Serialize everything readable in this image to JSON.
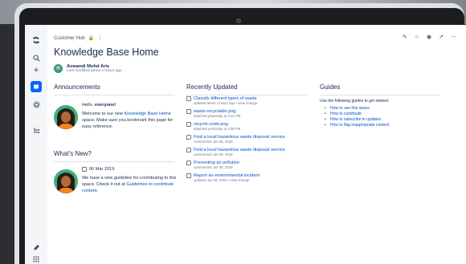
{
  "breadcrumb": {
    "space": "Customer Hub"
  },
  "page": {
    "title": "Knowledge Base Home",
    "author": "Azwandi Mohd Aris",
    "modified": "Last modified about 4 hours ago"
  },
  "announcements": {
    "heading": "Announcements",
    "greeting": "Hello, ",
    "greeting_name": "everyone!",
    "line1a": "Welcome to our new ",
    "line1_link": "Knowledge Base Home",
    "line1b": " space. Make sure you bookmark this page for easy reference."
  },
  "whats_new": {
    "heading": "What's New?",
    "date": "06 Mar 2019",
    "text_a": "We have a new guideline for contributing to this space. Check it out at ",
    "link": "Guidelines to contribute content",
    "text_b": "."
  },
  "recently_updated": {
    "heading": "Recently Updated",
    "items": [
      {
        "title": "Classify different types of waste",
        "meta": "updated about 4 hours ago • view change",
        "icon": "page-icon"
      },
      {
        "title": "waste-recyclable.png",
        "meta": "attached yesterday at 4:12 PM",
        "icon": "image-icon"
      },
      {
        "title": "recycle-code.png",
        "meta": "attached yesterday at 4:08 PM",
        "icon": "image-icon"
      },
      {
        "title": "Find a local hazardous waste disposal service",
        "meta": "commented Jun 06, 2019",
        "icon": "comment-icon"
      },
      {
        "title": "Find a local hazardous waste disposal service",
        "meta": "commented Jun 06, 2019",
        "icon": "comment-icon"
      },
      {
        "title": "Preventing air pollution",
        "meta": "commented Jun 06, 2019",
        "icon": "comment-icon"
      },
      {
        "title": "Report an environmental incident",
        "meta": "updated Jun 06, 2019 • view change",
        "icon": "page-icon"
      }
    ]
  },
  "guides": {
    "heading": "Guides",
    "intro": "Use the following guides to get started:",
    "items": [
      "How to use this space",
      "How to contribute",
      "How to subscribe to updates",
      "How to flag inappropriate content"
    ]
  },
  "colors": {
    "accent": "#0052cc",
    "sidebar_active": "#0065ff",
    "avatar_bg": "#36b37e"
  }
}
